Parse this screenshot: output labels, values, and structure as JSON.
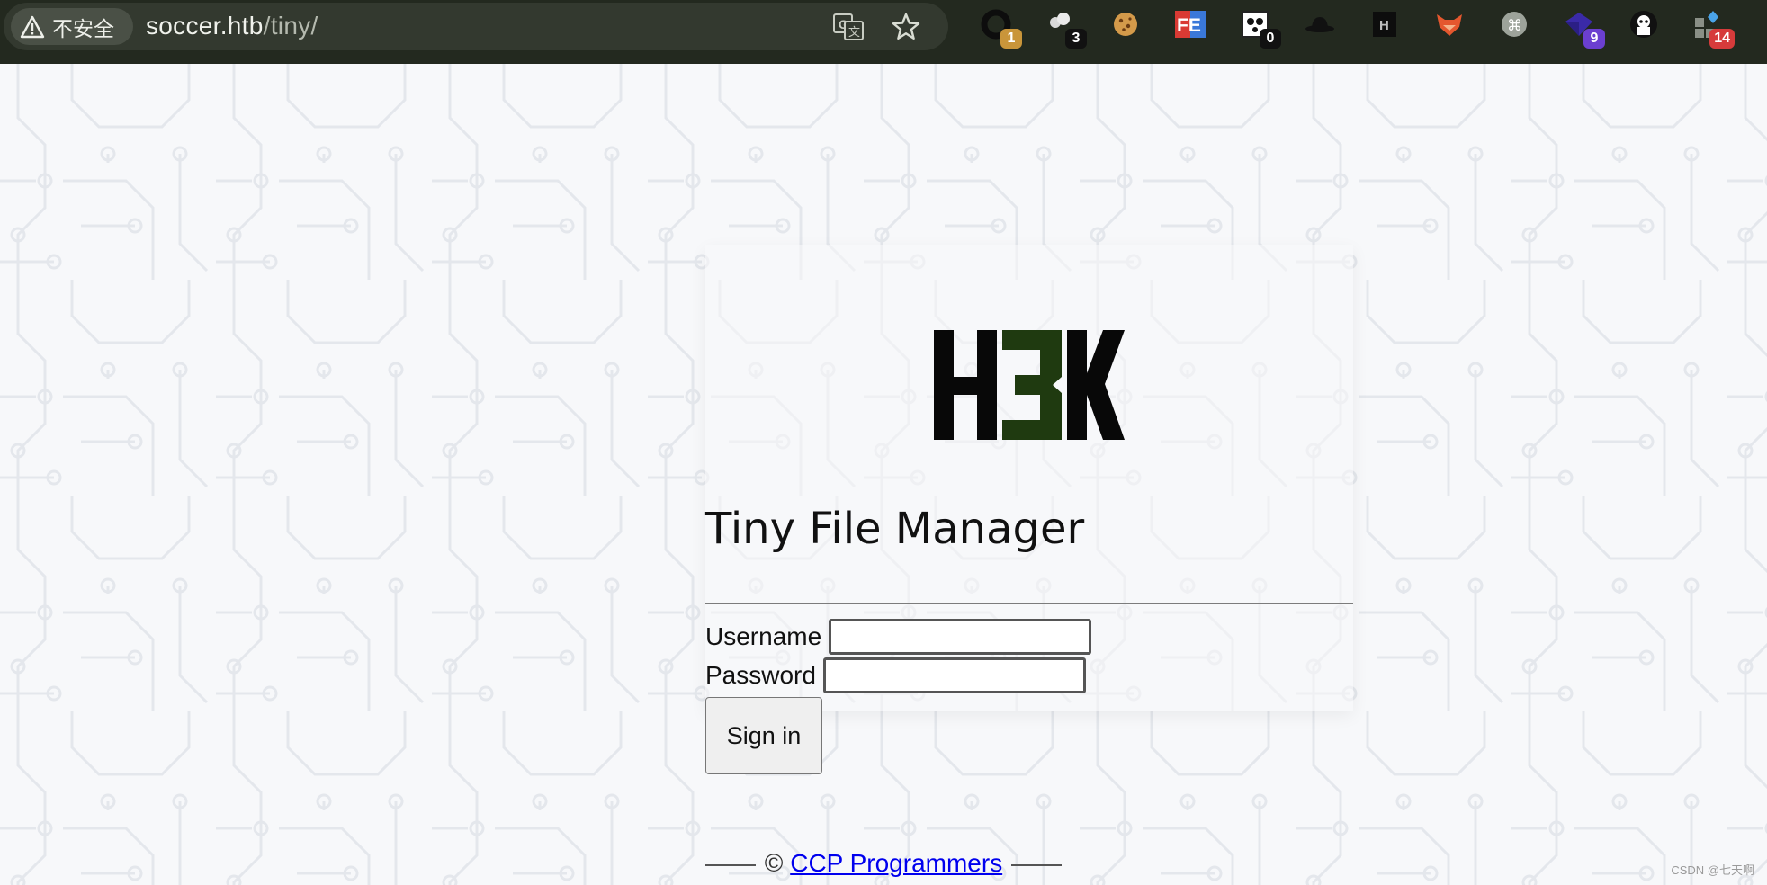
{
  "browser": {
    "security_label": "不安全",
    "url_host": "soccer.htb",
    "url_path": "/tiny/",
    "extensions": [
      {
        "name": "ext-ring",
        "badge": "1",
        "badge_color": "#c9953a"
      },
      {
        "name": "ext-cloud",
        "badge": "3",
        "badge_color": "#111111"
      },
      {
        "name": "ext-cookie",
        "badge": "",
        "badge_color": ""
      },
      {
        "name": "ext-fe",
        "badge": "",
        "badge_color": ""
      },
      {
        "name": "ext-panda",
        "badge": "0",
        "badge_color": "#111111"
      },
      {
        "name": "ext-hat",
        "badge": "",
        "badge_color": ""
      },
      {
        "name": "ext-h",
        "badge": "",
        "badge_color": ""
      },
      {
        "name": "ext-fox",
        "badge": "",
        "badge_color": ""
      },
      {
        "name": "ext-cmd",
        "badge": "",
        "badge_color": ""
      },
      {
        "name": "ext-gem",
        "badge": "9",
        "badge_color": "#6b3fd0"
      },
      {
        "name": "ext-ghost",
        "badge": "",
        "badge_color": ""
      },
      {
        "name": "ext-puzzle",
        "badge": "14",
        "badge_color": "#d63b3b"
      }
    ]
  },
  "logo": {
    "text_h": "H",
    "text_3": "3",
    "text_k": "K",
    "accent_color": "#1f3a10"
  },
  "login": {
    "title": "Tiny File Manager",
    "username_label": "Username",
    "password_label": "Password",
    "signin_label": "Sign in",
    "username_value": "",
    "password_value": ""
  },
  "footer": {
    "copyright": "©",
    "link_text": "CCP Programmers"
  },
  "watermark": "CSDN @七天啊"
}
